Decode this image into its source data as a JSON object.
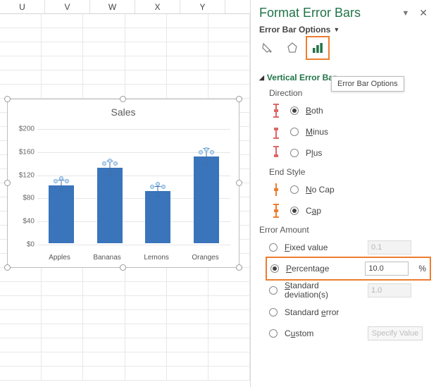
{
  "columns": [
    "U",
    "V",
    "W",
    "X",
    "Y"
  ],
  "pane": {
    "title": "Format Error Bars",
    "dropdown_label": "Error Bar Options",
    "tooltip": "Error Bar Options",
    "section": "Vertical Error Bar",
    "direction_label": "Direction",
    "direction": {
      "both": "Both",
      "minus": "Minus",
      "plus": "Plus"
    },
    "endstyle_label": "End Style",
    "endstyle": {
      "nocap": "No Cap",
      "cap": "Cap"
    },
    "amount_label": "Error Amount",
    "amount": {
      "fixed_label": "Fixed value",
      "fixed_value": "0.1",
      "percentage_label": "Percentage",
      "percentage_value": "10.0",
      "percentage_suffix": "%",
      "stddev_label": "Standard deviation(s)",
      "stddev_value": "1.0",
      "stderr_label": "Standard error",
      "custom_label": "Custom",
      "specify_btn": "Specify Value"
    }
  },
  "chart_data": {
    "type": "bar",
    "title": "Sales",
    "categories": [
      "Apples",
      "Bananas",
      "Lemons",
      "Oranges"
    ],
    "values": [
      100,
      130,
      90,
      150
    ],
    "error_percent": 10,
    "ylim": [
      0,
      200
    ],
    "ystep": 40,
    "yprefix": "$"
  }
}
